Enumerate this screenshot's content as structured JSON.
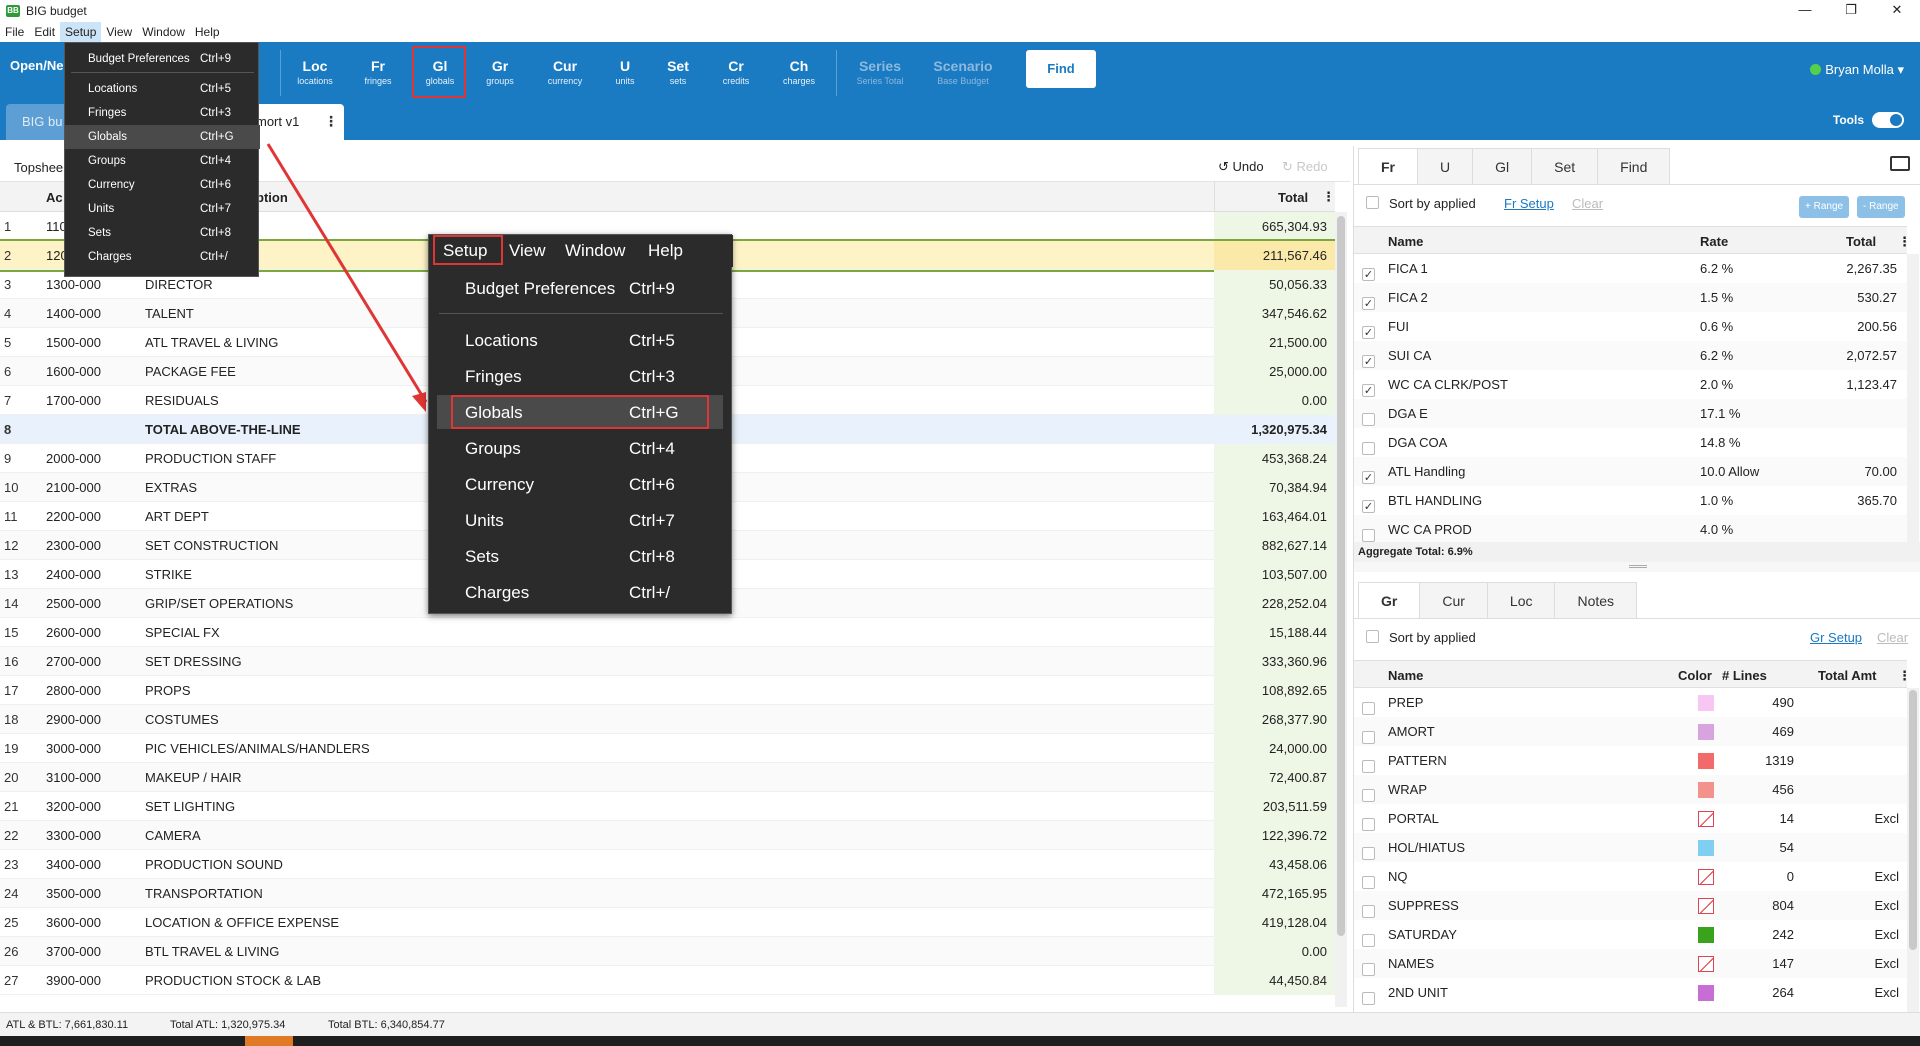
{
  "app": {
    "title": "BIG budget"
  },
  "menubar": [
    "File",
    "Edit",
    "Setup",
    "View",
    "Window",
    "Help"
  ],
  "toolbar": {
    "open_label": "Open/Ne",
    "buttons": [
      {
        "big": "Loc",
        "small": "locations"
      },
      {
        "big": "Fr",
        "small": "fringes"
      },
      {
        "big": "Gl",
        "small": "globals"
      },
      {
        "big": "Gr",
        "small": "groups"
      },
      {
        "big": "Cur",
        "small": "currency"
      },
      {
        "big": "U",
        "small": "units"
      },
      {
        "big": "Set",
        "small": "sets"
      },
      {
        "big": "Cr",
        "small": "credits"
      },
      {
        "big": "Ch",
        "small": "charges"
      }
    ],
    "series": {
      "big": "Series",
      "small": "Series Total"
    },
    "scenario": {
      "big": "Scenario",
      "small": "Base Budget"
    },
    "find": "Find",
    "user": "Bryan Molla",
    "tools": "Tools"
  },
  "tabs": {
    "budget": "BIG bu",
    "amort": "mort v1"
  },
  "grid": {
    "crumb": "Topshee",
    "undo": "Undo",
    "redo": "Redo",
    "header": {
      "account": "Ac",
      "description": "ption",
      "total": "Total"
    },
    "rows": [
      {
        "n": "1",
        "ac": "110",
        "de": "",
        "to": "665,304.93"
      },
      {
        "n": "2",
        "ac": "120",
        "de": "",
        "to": "211,567.46"
      },
      {
        "n": "3",
        "ac": "1300-000",
        "de": "DIRECTOR",
        "to": "50,056.33"
      },
      {
        "n": "4",
        "ac": "1400-000",
        "de": "TALENT",
        "to": "347,546.62"
      },
      {
        "n": "5",
        "ac": "1500-000",
        "de": "ATL TRAVEL & LIVING",
        "to": "21,500.00"
      },
      {
        "n": "6",
        "ac": "1600-000",
        "de": "PACKAGE FEE",
        "to": "25,000.00"
      },
      {
        "n": "7",
        "ac": "1700-000",
        "de": "RESIDUALS",
        "to": "0.00"
      },
      {
        "n": "8",
        "ac": "",
        "de": "TOTAL ABOVE-THE-LINE",
        "to": "1,320,975.34"
      },
      {
        "n": "9",
        "ac": "2000-000",
        "de": "PRODUCTION STAFF",
        "to": "453,368.24"
      },
      {
        "n": "10",
        "ac": "2100-000",
        "de": "EXTRAS",
        "to": "70,384.94"
      },
      {
        "n": "11",
        "ac": "2200-000",
        "de": "ART DEPT",
        "to": "163,464.01"
      },
      {
        "n": "12",
        "ac": "2300-000",
        "de": "SET CONSTRUCTION",
        "to": "882,627.14"
      },
      {
        "n": "13",
        "ac": "2400-000",
        "de": "STRIKE",
        "to": "103,507.00"
      },
      {
        "n": "14",
        "ac": "2500-000",
        "de": "GRIP/SET OPERATIONS",
        "to": "228,252.04"
      },
      {
        "n": "15",
        "ac": "2600-000",
        "de": "SPECIAL FX",
        "to": "15,188.44"
      },
      {
        "n": "16",
        "ac": "2700-000",
        "de": "SET DRESSING",
        "to": "333,360.96"
      },
      {
        "n": "17",
        "ac": "2800-000",
        "de": "PROPS",
        "to": "108,892.65"
      },
      {
        "n": "18",
        "ac": "2900-000",
        "de": "COSTUMES",
        "to": "268,377.90"
      },
      {
        "n": "19",
        "ac": "3000-000",
        "de": "PIC VEHICLES/ANIMALS/HANDLERS",
        "to": "24,000.00"
      },
      {
        "n": "20",
        "ac": "3100-000",
        "de": "MAKEUP / HAIR",
        "to": "72,400.87"
      },
      {
        "n": "21",
        "ac": "3200-000",
        "de": "SET LIGHTING",
        "to": "203,511.59"
      },
      {
        "n": "22",
        "ac": "3300-000",
        "de": "CAMERA",
        "to": "122,396.72"
      },
      {
        "n": "23",
        "ac": "3400-000",
        "de": "PRODUCTION SOUND",
        "to": "43,458.06"
      },
      {
        "n": "24",
        "ac": "3500-000",
        "de": "TRANSPORTATION",
        "to": "472,165.95"
      },
      {
        "n": "25",
        "ac": "3600-000",
        "de": "LOCATION & OFFICE EXPENSE",
        "to": "419,128.04"
      },
      {
        "n": "26",
        "ac": "3700-000",
        "de": "BTL TRAVEL & LIVING",
        "to": "0.00"
      },
      {
        "n": "27",
        "ac": "3900-000",
        "de": "PRODUCTION STOCK & LAB",
        "to": "44,450.84"
      }
    ]
  },
  "status": {
    "atl_btl": "ATL & BTL: 7,661,830.11",
    "total_atl": "Total ATL: 1,320,975.34",
    "total_btl": "Total BTL: 6,340,854.77"
  },
  "fringes_panel": {
    "tabs": [
      "Fr",
      "U",
      "Gl",
      "Set",
      "Find"
    ],
    "sort_label": "Sort by applied",
    "setup_link": "Fr Setup",
    "clear_link": "Clear",
    "range_plus": "+ Range",
    "range_minus": "- Range",
    "header": {
      "name": "Name",
      "rate": "Rate",
      "total": "Total"
    },
    "rows": [
      {
        "checked": true,
        "name": "FICA 1",
        "rate": "6.2 %",
        "total": "2,267.35"
      },
      {
        "checked": true,
        "name": "FICA 2",
        "rate": "1.5 %",
        "total": "530.27"
      },
      {
        "checked": true,
        "name": "FUI",
        "rate": "0.6 %",
        "total": "200.56"
      },
      {
        "checked": true,
        "name": "SUI CA",
        "rate": "6.2 %",
        "total": "2,072.57"
      },
      {
        "checked": true,
        "name": "WC CA CLRK/POST",
        "rate": "2.0 %",
        "total": "1,123.47"
      },
      {
        "checked": false,
        "name": "DGA E",
        "rate": "17.1 %",
        "total": ""
      },
      {
        "checked": false,
        "name": "DGA COA",
        "rate": "14.8 %",
        "total": ""
      },
      {
        "checked": true,
        "name": "ATL Handling",
        "rate": "10.0 Allow",
        "total": "70.00"
      },
      {
        "checked": true,
        "name": "BTL HANDLING",
        "rate": "1.0 %",
        "total": "365.70"
      },
      {
        "checked": false,
        "name": "WC CA PROD",
        "rate": "4.0 %",
        "total": ""
      }
    ],
    "aggregate": "Aggregate Total: 6.9%"
  },
  "groups_panel": {
    "tabs": [
      "Gr",
      "Cur",
      "Loc",
      "Notes"
    ],
    "sort_label": "Sort by applied",
    "setup_link": "Gr Setup",
    "clear_link": "Clear",
    "header": {
      "name": "Name",
      "color": "Color",
      "lines": "# Lines",
      "total": "Total Amt"
    },
    "rows": [
      {
        "name": "PREP",
        "color": "#f7c6f2",
        "lines": "490",
        "amt": ""
      },
      {
        "name": "AMORT",
        "color": "#d9a3e0",
        "lines": "469",
        "amt": ""
      },
      {
        "name": "PATTERN",
        "color": "#f26a6a",
        "lines": "1319",
        "amt": ""
      },
      {
        "name": "WRAP",
        "color": "#f2928a",
        "lines": "456",
        "amt": ""
      },
      {
        "name": "PORTAL",
        "color": "none",
        "lines": "14",
        "amt": "Excl"
      },
      {
        "name": "HOL/HIATUS",
        "color": "#7fd0f0",
        "lines": "54",
        "amt": ""
      },
      {
        "name": "NQ",
        "color": "none",
        "lines": "0",
        "amt": "Excl"
      },
      {
        "name": "SUPPRESS",
        "color": "none",
        "lines": "804",
        "amt": "Excl"
      },
      {
        "name": "SATURDAY",
        "color": "#3aa21c",
        "lines": "242",
        "amt": "Excl"
      },
      {
        "name": "NAMES",
        "color": "none",
        "lines": "147",
        "amt": "Excl"
      },
      {
        "name": "2ND UNIT",
        "color": "#c86cd6",
        "lines": "264",
        "amt": "Excl"
      }
    ]
  },
  "setup_menu": {
    "items": [
      {
        "label": "Budget Preferences",
        "shortcut": "Ctrl+9"
      },
      {
        "label": "Locations",
        "shortcut": "Ctrl+5"
      },
      {
        "label": "Fringes",
        "shortcut": "Ctrl+3"
      },
      {
        "label": "Globals",
        "shortcut": "Ctrl+G"
      },
      {
        "label": "Groups",
        "shortcut": "Ctrl+4"
      },
      {
        "label": "Currency",
        "shortcut": "Ctrl+6"
      },
      {
        "label": "Units",
        "shortcut": "Ctrl+7"
      },
      {
        "label": "Sets",
        "shortcut": "Ctrl+8"
      },
      {
        "label": "Charges",
        "shortcut": "Ctrl+/"
      }
    ]
  },
  "zoom_menubar": [
    "Setup",
    "View",
    "Window",
    "Help"
  ]
}
